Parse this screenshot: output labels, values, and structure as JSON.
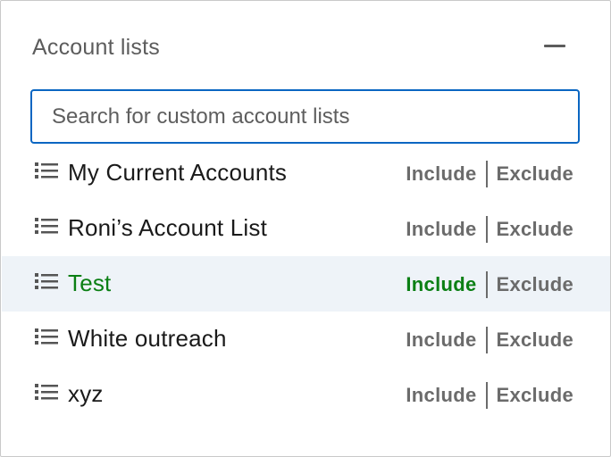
{
  "panel": {
    "title": "Account lists",
    "collapse_icon": "minus-icon"
  },
  "search": {
    "placeholder": "Search for custom account lists",
    "value": ""
  },
  "lists": [
    {
      "name": "My Current Accounts",
      "include_label": "Include",
      "exclude_label": "Exclude",
      "selected": false
    },
    {
      "name": "Roni’s Account List",
      "include_label": "Include",
      "exclude_label": "Exclude",
      "selected": false
    },
    {
      "name": "Test",
      "include_label": "Include",
      "exclude_label": "Exclude",
      "selected": true
    },
    {
      "name": "White outreach",
      "include_label": "Include",
      "exclude_label": "Exclude",
      "selected": false
    },
    {
      "name": "xyz",
      "include_label": "Include",
      "exclude_label": "Exclude",
      "selected": false
    }
  ],
  "colors": {
    "accent": "#0a66c2",
    "selected_text": "#0b7f14",
    "selected_row_bg": "#eef3f8",
    "muted": "#6b6b6b"
  }
}
